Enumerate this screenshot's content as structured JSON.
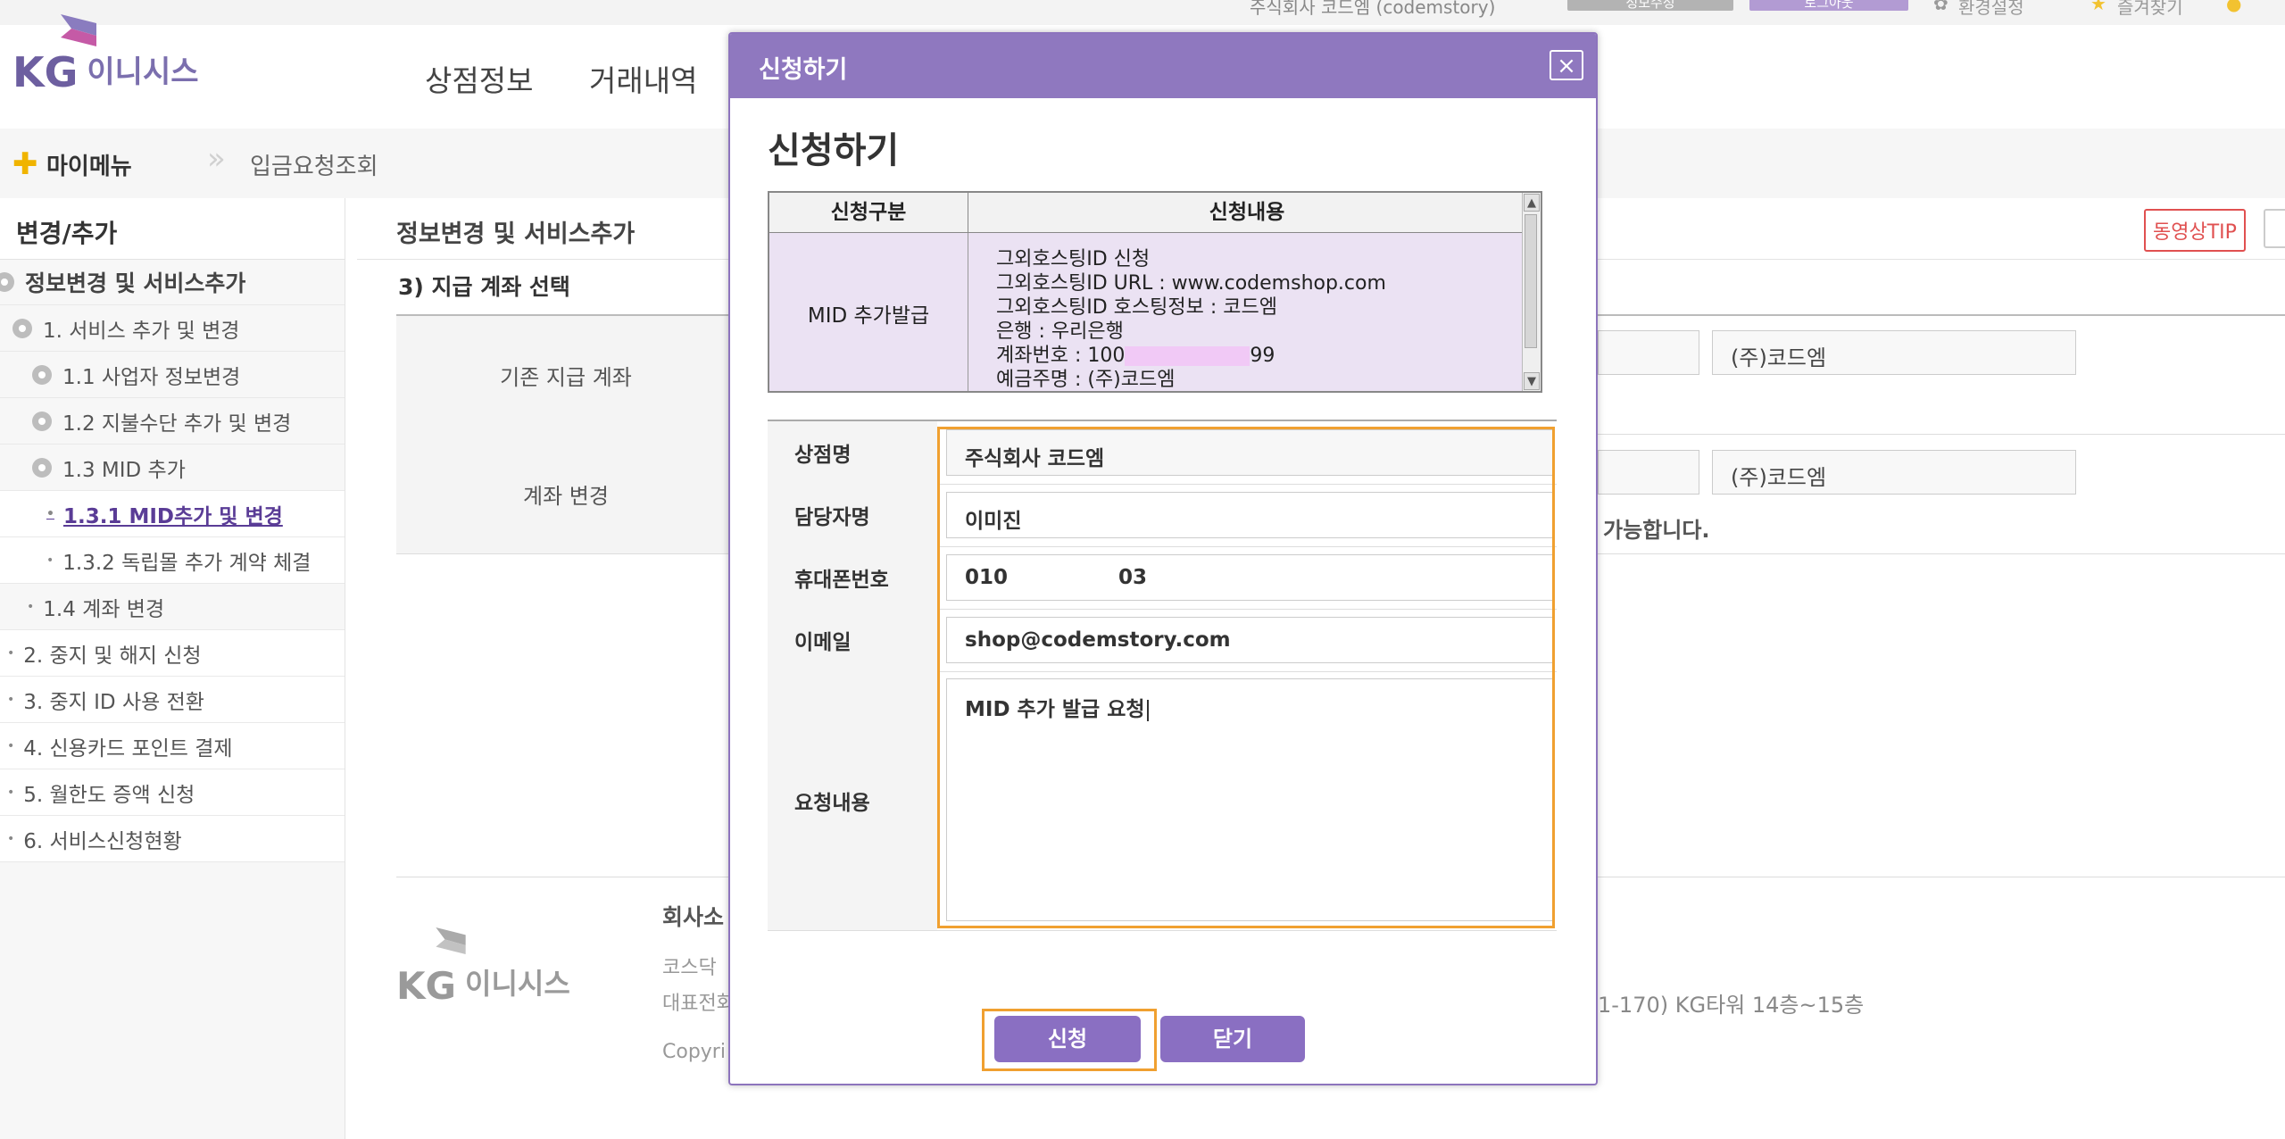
{
  "topbar": {
    "user_text": "주식회사 코드엠 (codemstory)",
    "pill1": "정보수정",
    "pill2": "로그아웃",
    "util1": "환경설정",
    "util2": "즐겨찾기"
  },
  "header": {
    "logo_kg": "KG",
    "logo_name": "이니시스",
    "nav": [
      "상점정보",
      "거래내역"
    ]
  },
  "breadcrumb": {
    "mymenu": "마이메뉴",
    "location": "입금요청조회"
  },
  "sidebar": {
    "title": "변경/추가",
    "items": [
      {
        "label": "정보변경 및 서비스추가"
      },
      {
        "label": "1. 서비스 추가 및 변경"
      },
      {
        "label": "1.1 사업자 정보변경"
      },
      {
        "label": "1.2 지불수단 추가 및 변경"
      },
      {
        "label": "1.3 MID 추가"
      },
      {
        "label": "1.3.1 MID추가 및 변경"
      },
      {
        "label": "1.3.2 독립몰 추가 계약 체결"
      },
      {
        "label": "1.4 계좌 변경"
      },
      {
        "label": "2. 중지 및 해지 신청"
      },
      {
        "label": "3. 중지 ID 사용 전환"
      },
      {
        "label": "4. 신용카드 포인트 결제"
      },
      {
        "label": "5. 월한도 증액 신청"
      },
      {
        "label": "6. 서비스신청현황"
      }
    ]
  },
  "content": {
    "title": "정보변경 및 서비스추가",
    "tip": "동영상TIP",
    "section_title": "3) 지급 계좌 선택",
    "row1_label": "기존 지급 계좌",
    "row1_value": "(주)코드엠",
    "row2_label": "계좌 변경",
    "row2_value": "(주)코드엠",
    "row2_note": "가능합니다.",
    "footer": {
      "company": "회사소",
      "line1": "코스닥",
      "line2": "대표전화",
      "line2_end": "1-170) KG타워 14층~15층",
      "line3": "Copyri"
    }
  },
  "modal": {
    "bar_title": "신청하기",
    "close_symbol": "×",
    "heading": "신청하기",
    "table": {
      "col1": "신청구분",
      "col2": "신청내용",
      "type": "MID 추가발급",
      "lines": [
        "그외호스팅ID 신청",
        "그외호스팅ID URL : www.codemshop.com",
        "그외호스팅ID 호스팅정보 : 코드엠",
        "은행 : 우리은행",
        "계좌번호 : 100",
        "예금주명 : (주)코드엠"
      ],
      "account_suffix": "99"
    },
    "form": {
      "store_label": "상점명",
      "store_value": "주식회사 코드엠",
      "manager_label": "담당자명",
      "manager_value": "이미진",
      "phone_label": "휴대폰번호",
      "phone_prefix": "010",
      "phone_suffix": "03",
      "email_label": "이메일",
      "email_value": "shop@codemstory.com",
      "request_label": "요청내용",
      "request_value": "MID 추가 발급 요청"
    },
    "buttons": {
      "apply": "신청",
      "close": "닫기"
    }
  },
  "colors": {
    "brand_purple": "#8f78bf",
    "highlight_orange": "#f0a030"
  }
}
